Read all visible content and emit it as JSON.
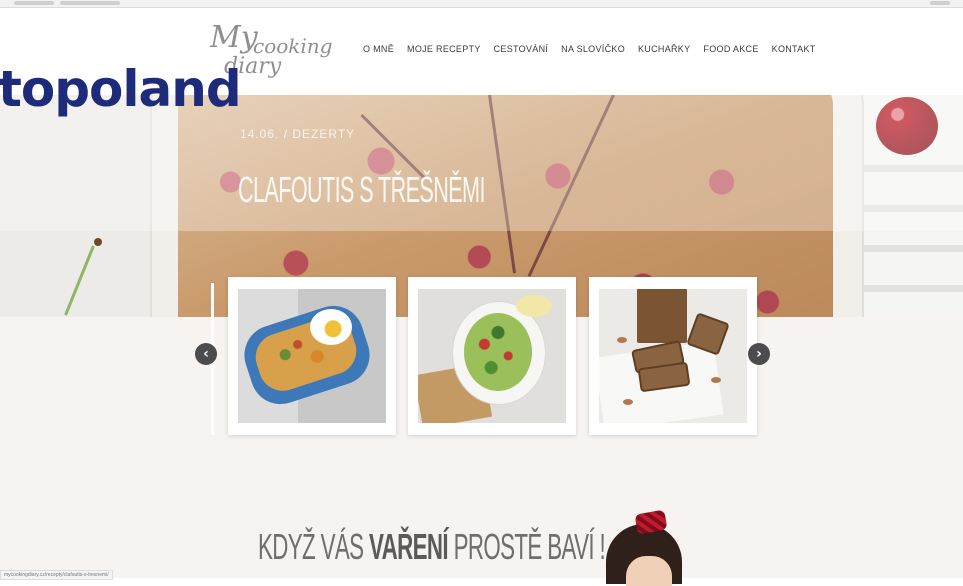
{
  "logo": {
    "line1": "My",
    "line2": "cooking",
    "line3": "diary"
  },
  "nav": {
    "items": [
      "O MNĚ",
      "MOJE RECEPTY",
      "CESTOVÁNÍ",
      "NA SLOVÍČKO",
      "KUCHAŘKY",
      "FOOD AKCE",
      "KONTAKT"
    ]
  },
  "hero": {
    "category": "14.06. / DEZERTY",
    "title": "CLAFOUTIS S TŘEŠNĚMI"
  },
  "watermark": {
    "text": "topoland"
  },
  "carousel": {
    "prev_icon": "chevron-left-icon",
    "next_icon": "chevron-right-icon",
    "prev_glyph": "‹",
    "next_glyph": "›"
  },
  "tagline": {
    "part1": "KDYŽ VÁS",
    "part2": "VAŘENÍ",
    "part3": "PROSTĚ BAVÍ !"
  },
  "status": {
    "url": "mycookingdiary.cz/recepty/clafoutis-s-tresnemi/"
  }
}
